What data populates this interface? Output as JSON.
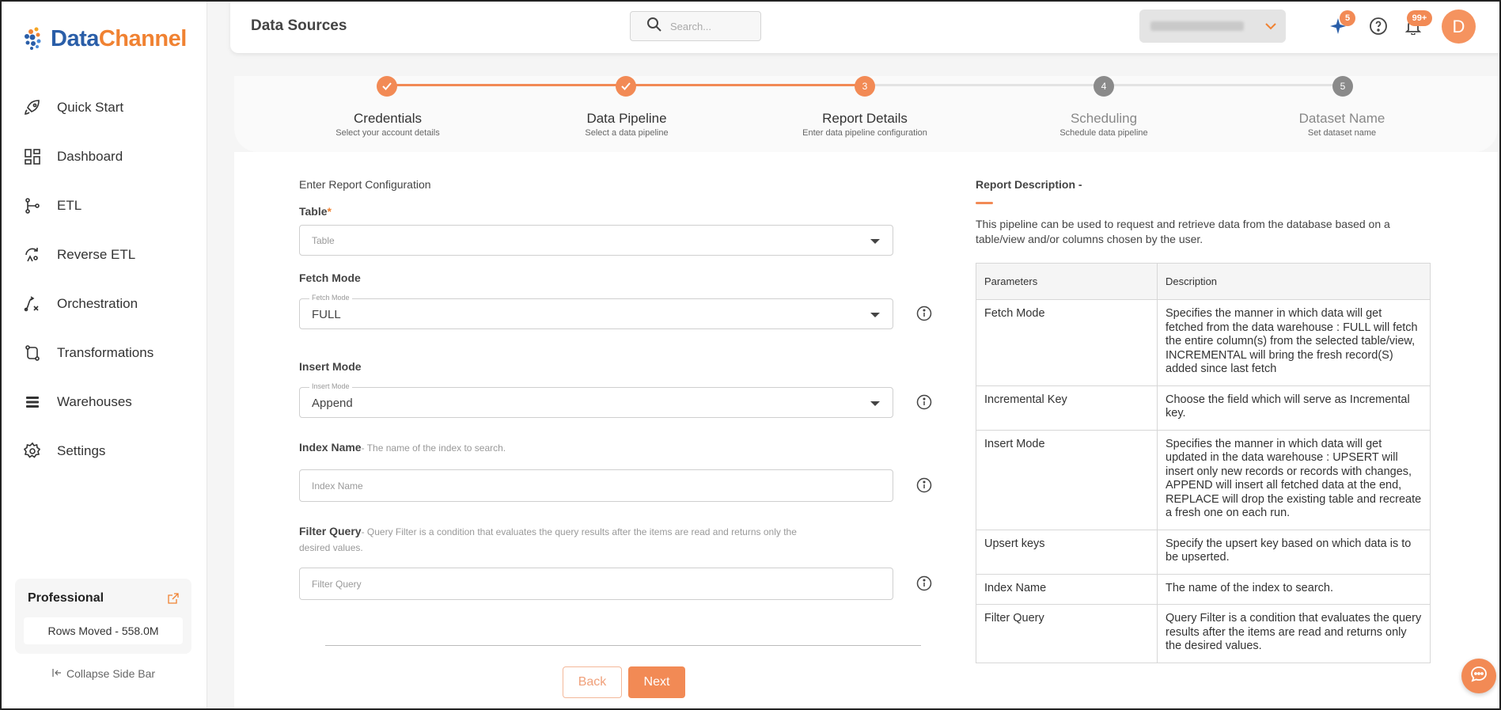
{
  "app": {
    "logo_text_part1": "Data",
    "logo_text_part2": "Channel"
  },
  "header": {
    "title": "Data Sources",
    "search_placeholder": "Search...",
    "sparkle_badge": "5",
    "notifications_badge": "99+",
    "avatar_initial": "D"
  },
  "sidebar": {
    "items": [
      {
        "label": "Quick Start",
        "icon": "rocket-icon"
      },
      {
        "label": "Dashboard",
        "icon": "dashboard-icon"
      },
      {
        "label": "ETL",
        "icon": "etl-icon"
      },
      {
        "label": "Reverse ETL",
        "icon": "reverse-etl-icon"
      },
      {
        "label": "Orchestration",
        "icon": "orchestration-icon"
      },
      {
        "label": "Transformations",
        "icon": "transformations-icon"
      },
      {
        "label": "Warehouses",
        "icon": "warehouses-icon"
      },
      {
        "label": "Settings",
        "icon": "gear-icon"
      }
    ],
    "plan": {
      "title": "Professional",
      "rows_moved": "Rows Moved - 558.0M"
    },
    "collapse_label": "Collapse Side Bar"
  },
  "stepper": {
    "steps": [
      {
        "number": "1",
        "name": "Credentials",
        "sub": "Select your account details",
        "state": "done"
      },
      {
        "number": "2",
        "name": "Data Pipeline",
        "sub": "Select a data pipeline",
        "state": "done"
      },
      {
        "number": "3",
        "name": "Report Details",
        "sub": "Enter data pipeline configuration",
        "state": "active"
      },
      {
        "number": "4",
        "name": "Scheduling",
        "sub": "Schedule data pipeline",
        "state": "pending"
      },
      {
        "number": "5",
        "name": "Dataset Name",
        "sub": "Set dataset name",
        "state": "pending"
      }
    ]
  },
  "form": {
    "section_title": "Enter Report Configuration",
    "table": {
      "label": "Table",
      "required_mark": "*",
      "placeholder": "Table"
    },
    "fetch_mode": {
      "label": "Fetch Mode",
      "float_label": "Fetch Mode",
      "value": "FULL"
    },
    "insert_mode": {
      "label": "Insert Mode",
      "float_label": "Insert Mode",
      "value": "Append"
    },
    "index_name": {
      "label": "Index Name",
      "hint": "- The name of the index to search.",
      "placeholder": "Index Name"
    },
    "filter_query": {
      "label": "Filter Query",
      "hint_line1": "- Query Filter is a condition that evaluates the query results after the items are read and returns only the",
      "hint_line2": "desired values.",
      "placeholder": "Filter Query"
    },
    "back_label": "Back",
    "next_label": "Next"
  },
  "report_description": {
    "title": "Report Description -",
    "text": "This pipeline can be used to request and retrieve data from the database based on a table/view and/or columns chosen by the user.",
    "table_headers": {
      "param": "Parameters",
      "desc": "Description"
    },
    "rows": [
      {
        "param": "Fetch Mode",
        "desc": "Specifies the manner in which data will get fetched from the data warehouse : FULL will fetch the entire column(s) from the selected table/view, INCREMENTAL will bring the fresh record(S) added since last fetch"
      },
      {
        "param": "Incremental Key",
        "desc": "Choose the field which will serve as Incremental key."
      },
      {
        "param": "Insert Mode",
        "desc": "Specifies the manner in which data will get updated in the data warehouse : UPSERT will insert only new records or records with changes, APPEND will insert all fetched data at the end, REPLACE will drop the existing table and recreate a fresh one on each run."
      },
      {
        "param": "Upsert keys",
        "desc": "Specify the upsert key based on which data is to be upserted."
      },
      {
        "param": "Index Name",
        "desc": "The name of the index to search."
      },
      {
        "param": "Filter Query",
        "desc": "Query Filter is a condition that evaluates the query results after the items are read and returns only the desired values."
      }
    ]
  },
  "colors": {
    "accent": "#f28a55",
    "brand_blue": "#2a5ea8",
    "brand_orange": "#f08232",
    "step_pending": "#8a8a8a"
  }
}
